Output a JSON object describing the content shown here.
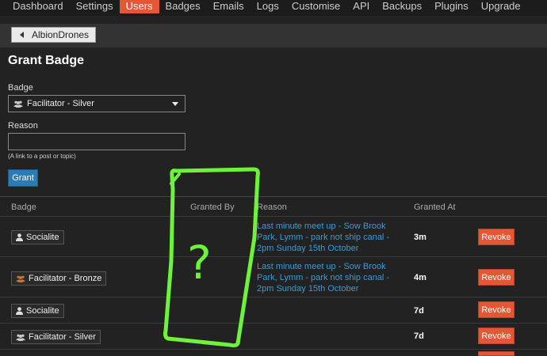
{
  "nav": {
    "items": [
      "Dashboard",
      "Settings",
      "Users",
      "Badges",
      "Emails",
      "Logs",
      "Customise",
      "API",
      "Backups",
      "Plugins",
      "Upgrade"
    ],
    "active_index": 2
  },
  "breadcrumb": {
    "back_label": "AlbionDrones"
  },
  "page_title": "Grant Badge",
  "form": {
    "badge_label": "Badge",
    "badge_selected": "Facilitator - Silver",
    "reason_label": "Reason",
    "reason_value": "",
    "reason_hint": "(A link to a post or topic)",
    "grant_label": "Grant"
  },
  "table": {
    "headers": {
      "badge": "Badge",
      "granted_by": "Granted By",
      "reason": "Reason",
      "granted_at": "Granted At"
    },
    "revoke_label": "Revoke",
    "rows": [
      {
        "badge": "Socialite",
        "icon": "user-icon",
        "reason": "Last minute meet up - Sow Brook Park, Lymm - park not ship canal - 2pm Sunday 15th October",
        "granted_at": "3m"
      },
      {
        "badge": "Facilitator - Bronze",
        "icon": "users-icon",
        "reason": "Last minute meet up - Sow Brook Park, Lymm - park not ship canal - 2pm Sunday 15th October",
        "granted_at": "4m"
      },
      {
        "badge": "Socialite",
        "icon": "user-icon",
        "reason": "",
        "granted_at": "7d"
      },
      {
        "badge": "Facilitator - Silver",
        "icon": "users-icon",
        "reason": "",
        "granted_at": "7d"
      }
    ]
  },
  "annotation": {
    "text": "?",
    "color": "#6ef23a"
  },
  "colors": {
    "accent": "#e45735",
    "link": "#3a9bd5",
    "primary_button": "#2b7bb9",
    "bronze_icon": "#c87533"
  }
}
